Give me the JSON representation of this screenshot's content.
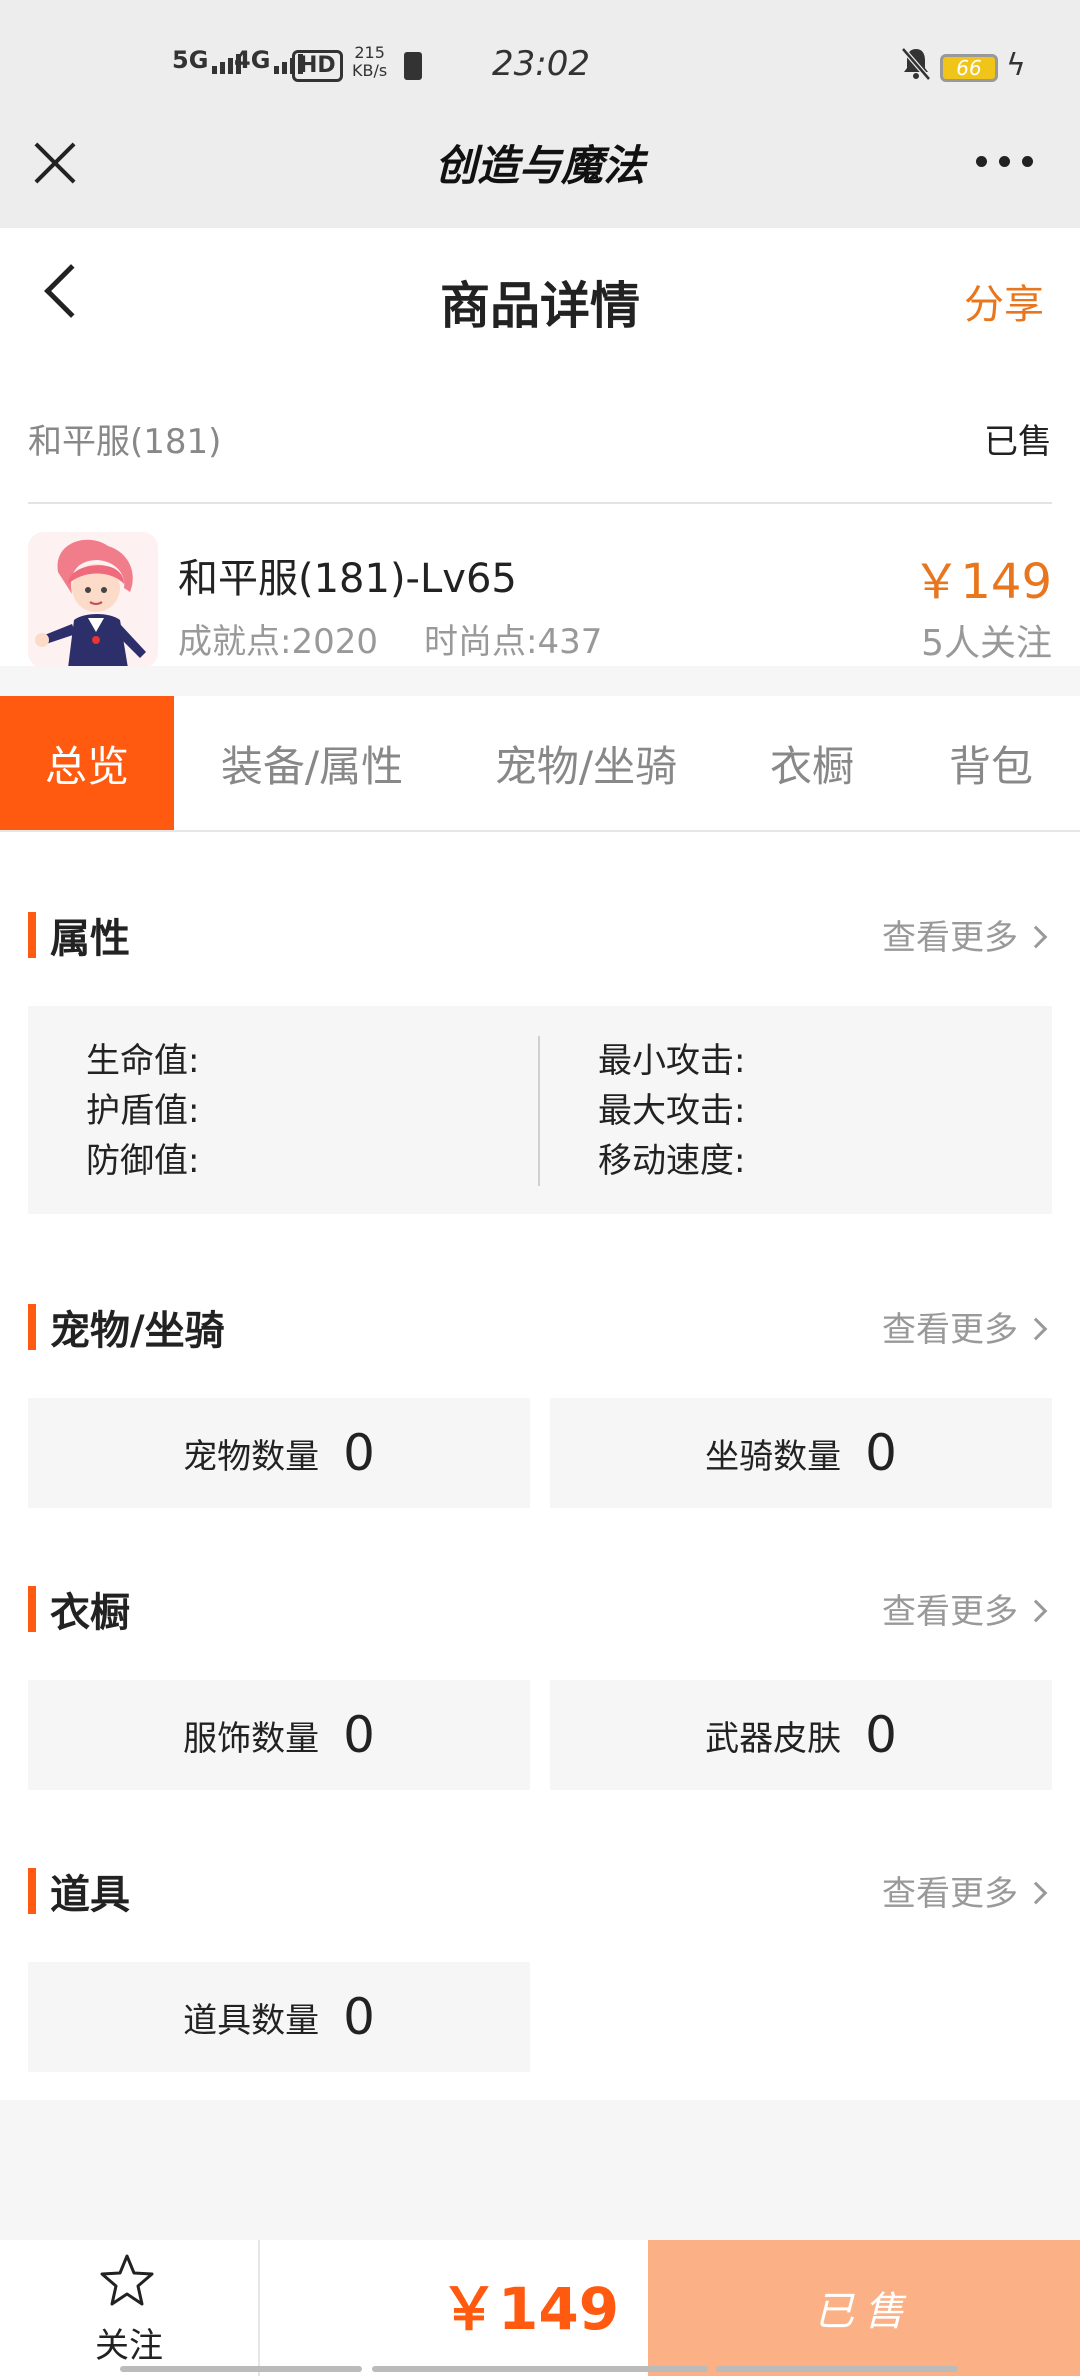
{
  "status_bar": {
    "net1": "5G",
    "net2": "4G",
    "hd": "HD",
    "speed_value": "215",
    "speed_unit": "KB/s",
    "time": "23:02",
    "battery": "66"
  },
  "header": {
    "app_title": "创造与魔法",
    "page_title": "商品详情",
    "share_label": "分享"
  },
  "product": {
    "server": "和平服(181)",
    "status": "已售",
    "name": "和平服(181)-Lv65",
    "achievement": "成就点:2020",
    "fashion": "时尚点:437",
    "price": "￥149",
    "follow_count": "5人关注"
  },
  "tabs": [
    {
      "label": "总览",
      "active": true
    },
    {
      "label": "装备/属性",
      "active": false
    },
    {
      "label": "宠物/坐骑",
      "active": false
    },
    {
      "label": "衣橱",
      "active": false
    },
    {
      "label": "背包",
      "active": false
    }
  ],
  "more_label": "查看更多",
  "attributes": {
    "title": "属性",
    "left": [
      "生命值:",
      "护盾值:",
      "防御值:"
    ],
    "right": [
      "最小攻击:",
      "最大攻击:",
      "移动速度:"
    ]
  },
  "pets": {
    "title": "宠物/坐骑",
    "pet_label": "宠物数量",
    "pet_count": "0",
    "mount_label": "坐骑数量",
    "mount_count": "0"
  },
  "wardrobe": {
    "title": "衣橱",
    "costume_label": "服饰数量",
    "costume_count": "0",
    "skin_label": "武器皮肤",
    "skin_count": "0"
  },
  "items": {
    "title": "道具",
    "item_label": "道具数量",
    "item_count": "0"
  },
  "bottom_bar": {
    "follow_label": "关注",
    "price": "￥149",
    "buy_label": "已售"
  },
  "colors": {
    "accent": "#ff5a0f",
    "price": "#e8761e",
    "sold_button": "#fbb185"
  }
}
